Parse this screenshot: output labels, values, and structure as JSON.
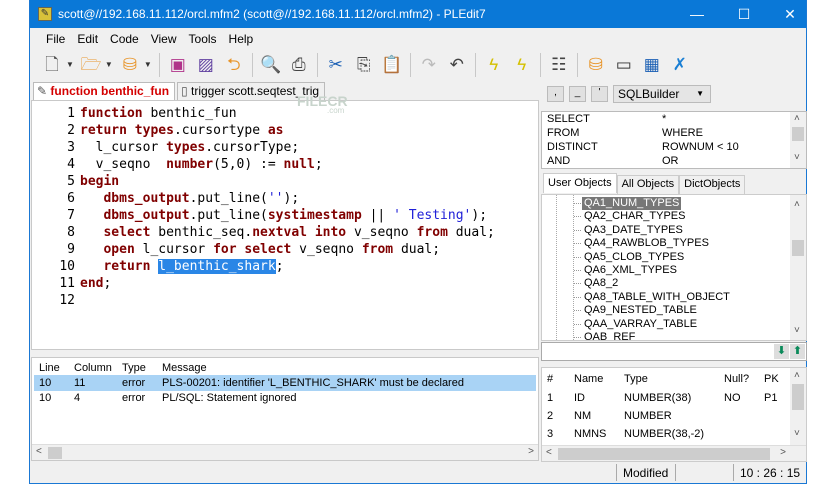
{
  "window": {
    "title": "scott@//192.168.11.112/orcl.mfm2 (scott@//192.168.11.112/orcl.mfm2) - PLEdit7",
    "app_icon": "pledit-icon",
    "title_color": "#0a78d7"
  },
  "menu": [
    "File",
    "Edit",
    "Code",
    "View",
    "Tools",
    "Help"
  ],
  "toolbar_icons": [
    "new-file-icon",
    "open-folder-icon",
    "database-connect-icon",
    "save-icon",
    "save-as-icon",
    "open-recent-icon",
    "print-preview-icon",
    "print-icon",
    "cut-icon",
    "copy-icon",
    "paste-icon",
    "redo-icon",
    "undo-icon",
    "compile-icon",
    "compile-one-icon",
    "tree-icon",
    "db-tools-icon",
    "window-split-icon",
    "table-grid-icon",
    "settings-tools-icon"
  ],
  "tabs": [
    {
      "label": "function benthic_fun",
      "active": true
    },
    {
      "label": "trigger scott.seqtest_trig",
      "active": false
    }
  ],
  "watermark": {
    "text": "FILECR",
    "sub": ".com"
  },
  "editor": {
    "colors": {
      "keyword": "#800000",
      "string": "#2020d8",
      "selection": "#2a86e6"
    },
    "lines": [
      {
        "n": "1",
        "tokens": [
          [
            "kw",
            "function"
          ],
          [
            "t",
            " benthic_fun"
          ]
        ]
      },
      {
        "n": "2",
        "tokens": [
          [
            "kw",
            "return"
          ],
          [
            "t",
            " "
          ],
          [
            "kw",
            "types"
          ],
          [
            "t",
            ".cursortype "
          ],
          [
            "kw",
            "as"
          ]
        ]
      },
      {
        "n": "3",
        "tokens": [
          [
            "t",
            "  l_cursor "
          ],
          [
            "kw",
            "types"
          ],
          [
            "t",
            ".cursorType;"
          ]
        ]
      },
      {
        "n": "4",
        "tokens": [
          [
            "t",
            "  v_seqno  "
          ],
          [
            "kw",
            "number"
          ],
          [
            "t",
            "(5,0) := "
          ],
          [
            "kw",
            "null"
          ],
          [
            "t",
            ";"
          ]
        ]
      },
      {
        "n": "5",
        "tokens": [
          [
            "kw",
            "begin"
          ]
        ]
      },
      {
        "n": "6",
        "tokens": [
          [
            "t",
            "   "
          ],
          [
            "kw",
            "dbms_output"
          ],
          [
            "t",
            ".put_line("
          ],
          [
            "str",
            "''"
          ],
          [
            "t",
            ");"
          ]
        ]
      },
      {
        "n": "7",
        "tokens": [
          [
            "t",
            "   "
          ],
          [
            "kw",
            "dbms_output"
          ],
          [
            "t",
            ".put_line("
          ],
          [
            "kw",
            "systimestamp"
          ],
          [
            "t",
            " || "
          ],
          [
            "str",
            "' Testing'"
          ],
          [
            "t",
            ");"
          ]
        ]
      },
      {
        "n": "8",
        "tokens": [
          [
            "t",
            "   "
          ],
          [
            "kw",
            "select"
          ],
          [
            "t",
            " benthic_seq."
          ],
          [
            "kw",
            "nextval"
          ],
          [
            "t",
            " "
          ],
          [
            "kw",
            "into"
          ],
          [
            "t",
            " v_seqno "
          ],
          [
            "kw",
            "from"
          ],
          [
            "t",
            " dual;"
          ]
        ]
      },
      {
        "n": "9",
        "tokens": [
          [
            "t",
            "   "
          ],
          [
            "kw",
            "open"
          ],
          [
            "t",
            " l_cursor "
          ],
          [
            "kw",
            "for"
          ],
          [
            "t",
            " "
          ],
          [
            "kw",
            "select"
          ],
          [
            "t",
            " v_seqno "
          ],
          [
            "kw",
            "from"
          ],
          [
            "t",
            " dual;"
          ]
        ]
      },
      {
        "n": "10",
        "tokens": [
          [
            "t",
            "   "
          ],
          [
            "kw",
            "return"
          ],
          [
            "t",
            " "
          ],
          [
            "sel",
            "l_benthic_shark"
          ],
          [
            "t",
            ";"
          ]
        ]
      },
      {
        "n": "11",
        "tokens": [
          [
            "kw",
            "end"
          ],
          [
            "t",
            ";"
          ]
        ]
      },
      {
        "n": "12",
        "tokens": []
      }
    ]
  },
  "messages": {
    "headers": [
      "Line",
      "Column",
      "Type",
      "Message"
    ],
    "rows": [
      {
        "line": "10",
        "column": "11",
        "type": "error",
        "message": "PLS-00201: identifier 'L_BENTHIC_SHARK' must be declared",
        "selected": true
      },
      {
        "line": "10",
        "column": "4",
        "type": "error",
        "message": "PL/SQL: Statement ignored",
        "selected": false
      }
    ]
  },
  "status": {
    "modified": "Modified",
    "time": "10 : 26 : 15"
  },
  "sql_panel": {
    "buttons": [
      ",",
      "_",
      "'"
    ],
    "combo": "SQLBuilder",
    "keywords": [
      [
        "SELECT",
        "*"
      ],
      [
        "FROM",
        "WHERE"
      ],
      [
        "DISTINCT",
        "ROWNUM < 10"
      ],
      [
        "AND",
        "OR"
      ]
    ]
  },
  "object_tabs": [
    {
      "label": "User Objects",
      "active": true
    },
    {
      "label": "All Objects",
      "active": false
    },
    {
      "label": "DictObjects",
      "active": false
    }
  ],
  "objects": [
    "QA1_NUM_TYPES",
    "QA2_CHAR_TYPES",
    "QA3_DATE_TYPES",
    "QA4_RAWBLOB_TYPES",
    "QA5_CLOB_TYPES",
    "QA6_XML_TYPES",
    "QA8_2",
    "QA8_TABLE_WITH_OBJECT",
    "QA9_NESTED_TABLE",
    "QAA_VARRAY_TABLE",
    "QAB_REF"
  ],
  "selected_object": "QA1_NUM_TYPES",
  "filter": {
    "value": ""
  },
  "columns": {
    "headers": [
      "#",
      "Name",
      "Type",
      "Null?",
      "PK"
    ],
    "rows": [
      [
        "1",
        "ID",
        "NUMBER(38)",
        "NO",
        "P1"
      ],
      [
        "2",
        "NM",
        "NUMBER",
        "",
        ""
      ],
      [
        "3",
        "NMNS",
        "NUMBER(38,-2)",
        "",
        ""
      ]
    ]
  }
}
